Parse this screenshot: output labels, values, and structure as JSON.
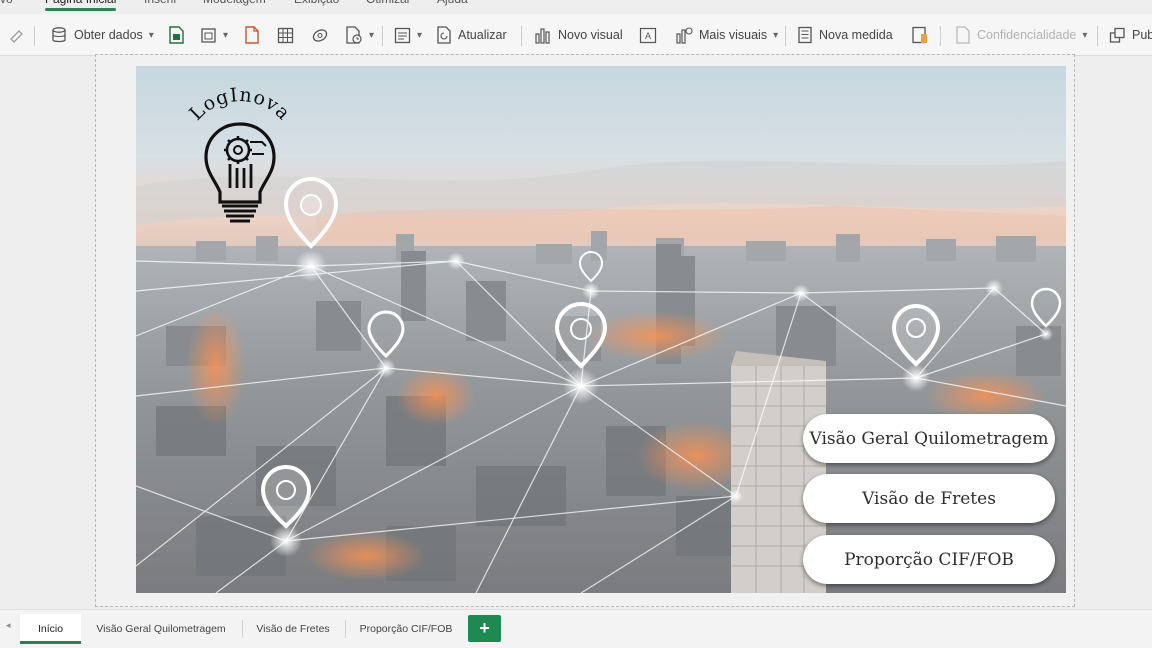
{
  "ribbon": {
    "tabs": [
      {
        "label": "vo"
      },
      {
        "label": "Página Inicial",
        "active": true
      },
      {
        "label": "Inserir"
      },
      {
        "label": "Modelagem"
      },
      {
        "label": "Exibição"
      },
      {
        "label": "Otimizar"
      },
      {
        "label": "Ajuda"
      }
    ]
  },
  "toolbar": {
    "get_data": "Obter dados",
    "refresh": "Atualizar",
    "new_visual": "Novo visual",
    "more_visuals": "Mais visuais",
    "new_measure": "Nova medida",
    "sensitivity": "Confidencialidade",
    "publish": "Pub"
  },
  "report": {
    "logo_text": "LogInova",
    "buttons": [
      {
        "label": "Visão Geral Quilometragem"
      },
      {
        "label": "Visão de Fretes"
      },
      {
        "label": "Proporção CIF/FOB"
      }
    ]
  },
  "page_tabs": {
    "tabs": [
      {
        "label": "Início",
        "active": true
      },
      {
        "label": "Visão Geral Quilometragem"
      },
      {
        "label": "Visão de Fretes"
      },
      {
        "label": "Proporção CIF/FOB"
      }
    ],
    "add_label": "+"
  },
  "colors": {
    "accent": "#2f7f57",
    "add_button": "#1e8a52"
  }
}
